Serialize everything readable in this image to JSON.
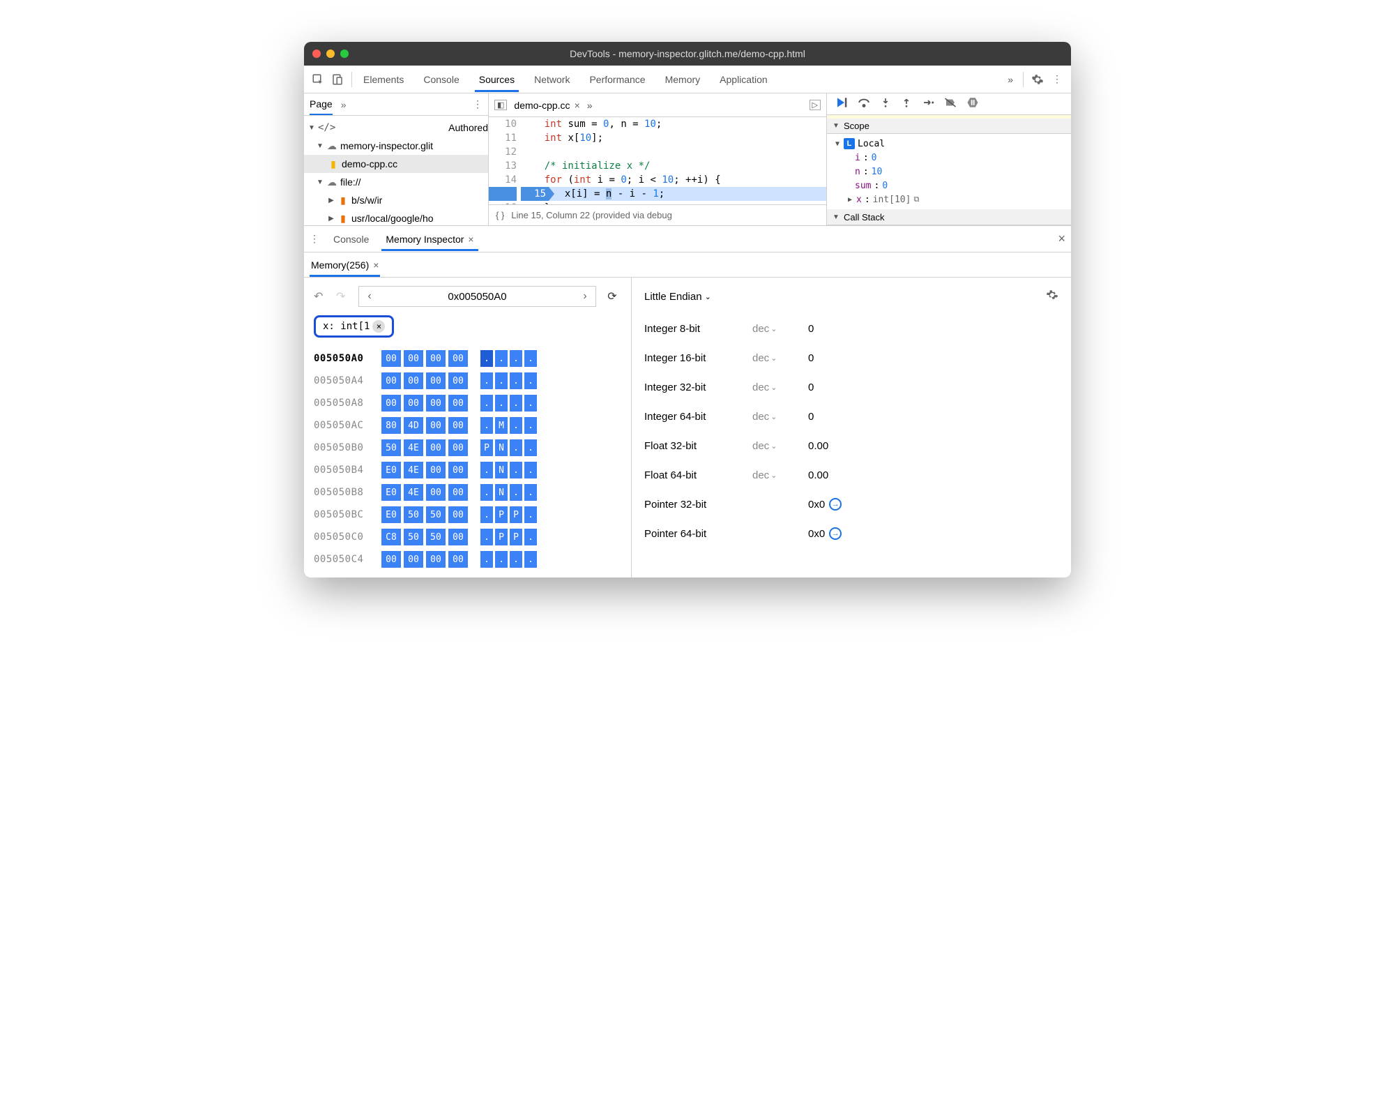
{
  "window": {
    "title": "DevTools - memory-inspector.glitch.me/demo-cpp.html"
  },
  "topTabs": {
    "items": [
      "Elements",
      "Console",
      "Sources",
      "Network",
      "Performance",
      "Memory",
      "Application"
    ],
    "activeIndex": 2
  },
  "navigator": {
    "pageTab": "Page",
    "tree": {
      "authored": "Authored",
      "domain": "memory-inspector.glit",
      "file": "demo-cpp.cc",
      "fileScheme": "file://",
      "folder1": "b/s/w/ir",
      "folder2": "usr/local/google/ho"
    }
  },
  "editor": {
    "fileTab": "demo-cpp.cc",
    "lines": {
      "l10": "    int sum = 0, n = 10;",
      "l11": "    int x[10];",
      "l12": "",
      "l13": "    /* initialize x */",
      "l14": "    for (int i = 0; i < 10; ++i) {",
      "l15": "      x[i] = n - i - 1;",
      "l16": "    }"
    },
    "status": "Line 15, Column 22 (provided via debug"
  },
  "scope": {
    "header": "Scope",
    "local": "Local",
    "vars": {
      "i": {
        "name": "i",
        "value": "0"
      },
      "n": {
        "name": "n",
        "value": "10"
      },
      "sum": {
        "name": "sum",
        "value": "0"
      },
      "x": {
        "name": "x",
        "type": "int[10]"
      }
    },
    "callstack": "Call Stack"
  },
  "drawer": {
    "consoleTab": "Console",
    "miTab": "Memory Inspector",
    "memTab": "Memory(256)"
  },
  "memory": {
    "address": "0x005050A0",
    "chip": "x: int[1",
    "rows": [
      {
        "addr": "005050A0",
        "bytes": [
          "00",
          "00",
          "00",
          "00"
        ],
        "ascii": [
          ".",
          ".",
          ".",
          "."
        ],
        "current": true,
        "darkFirst": true
      },
      {
        "addr": "005050A4",
        "bytes": [
          "00",
          "00",
          "00",
          "00"
        ],
        "ascii": [
          ".",
          ".",
          ".",
          "."
        ]
      },
      {
        "addr": "005050A8",
        "bytes": [
          "00",
          "00",
          "00",
          "00"
        ],
        "ascii": [
          ".",
          ".",
          ".",
          "."
        ]
      },
      {
        "addr": "005050AC",
        "bytes": [
          "80",
          "4D",
          "00",
          "00"
        ],
        "ascii": [
          ".",
          "M",
          ".",
          "."
        ]
      },
      {
        "addr": "005050B0",
        "bytes": [
          "50",
          "4E",
          "00",
          "00"
        ],
        "ascii": [
          "P",
          "N",
          ".",
          "."
        ]
      },
      {
        "addr": "005050B4",
        "bytes": [
          "E0",
          "4E",
          "00",
          "00"
        ],
        "ascii": [
          ".",
          "N",
          ".",
          "."
        ]
      },
      {
        "addr": "005050B8",
        "bytes": [
          "E0",
          "4E",
          "00",
          "00"
        ],
        "ascii": [
          ".",
          "N",
          ".",
          "."
        ]
      },
      {
        "addr": "005050BC",
        "bytes": [
          "E0",
          "50",
          "50",
          "00"
        ],
        "ascii": [
          ".",
          "P",
          "P",
          "."
        ]
      },
      {
        "addr": "005050C0",
        "bytes": [
          "C8",
          "50",
          "50",
          "00"
        ],
        "ascii": [
          ".",
          "P",
          "P",
          "."
        ]
      },
      {
        "addr": "005050C4",
        "bytes": [
          "00",
          "00",
          "00",
          "00"
        ],
        "ascii": [
          ".",
          ".",
          ".",
          "."
        ]
      }
    ]
  },
  "values": {
    "endian": "Little Endian",
    "decLabel": "dec",
    "rows": [
      {
        "label": "Integer 8-bit",
        "fmt": true,
        "value": "0"
      },
      {
        "label": "Integer 16-bit",
        "fmt": true,
        "value": "0"
      },
      {
        "label": "Integer 32-bit",
        "fmt": true,
        "value": "0"
      },
      {
        "label": "Integer 64-bit",
        "fmt": true,
        "value": "0"
      },
      {
        "label": "Float 32-bit",
        "fmt": true,
        "value": "0.00"
      },
      {
        "label": "Float 64-bit",
        "fmt": true,
        "value": "0.00"
      },
      {
        "label": "Pointer 32-bit",
        "fmt": false,
        "value": "0x0",
        "ptr": true
      },
      {
        "label": "Pointer 64-bit",
        "fmt": false,
        "value": "0x0",
        "ptr": true
      }
    ]
  }
}
